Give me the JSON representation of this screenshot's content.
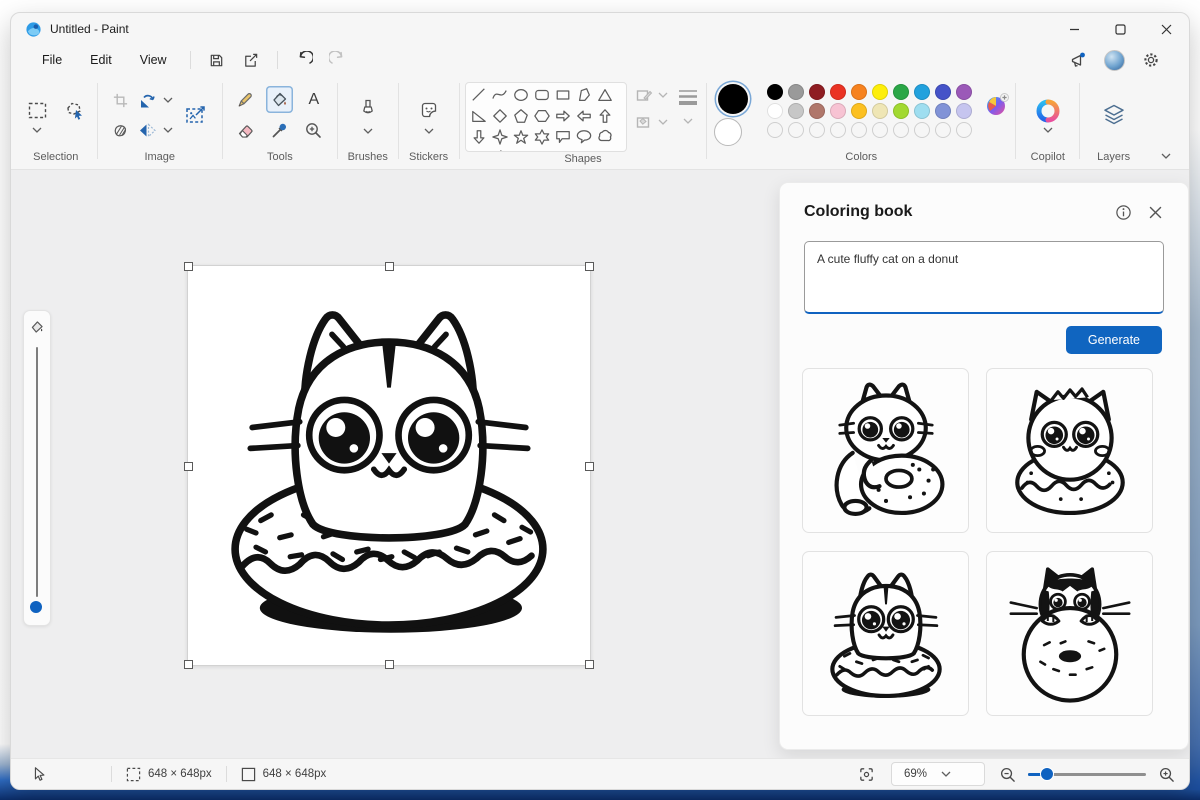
{
  "window": {
    "title": "Untitled - Paint"
  },
  "menubar": {
    "items": [
      "File",
      "Edit",
      "View"
    ]
  },
  "ribbon": {
    "groups": [
      {
        "label": "Selection"
      },
      {
        "label": "Image"
      },
      {
        "label": "Tools"
      },
      {
        "label": "Brushes"
      },
      {
        "label": "Stickers"
      },
      {
        "label": "Shapes"
      },
      {
        "label": "Colors"
      },
      {
        "label": "Copilot"
      },
      {
        "label": "Layers"
      }
    ],
    "selected_tool": "Fill"
  },
  "icons": {
    "text_tool": "A",
    "minimize": "minimize",
    "maximize": "maximize",
    "close": "close",
    "info": "info",
    "save": "floppy-disk",
    "share": "share-arrow",
    "undo": "undo-arrow",
    "redo": "redo-arrow",
    "feedback": "megaphone",
    "settings": "gear"
  },
  "colors": {
    "primary": "#000000",
    "secondary": "#ffffff",
    "row1": [
      "#000000",
      "#9a9a9a",
      "#8f1d22",
      "#ea3323",
      "#f6821f",
      "#fdee0a",
      "#2aa646",
      "#22a1dd",
      "#4553c8",
      "#9b59b8"
    ],
    "row2": [
      "#ffffff",
      "#c7c7c7",
      "#b0776b",
      "#f7c3d3",
      "#fcc021",
      "#efe6b5",
      "#a2d931",
      "#9fdef0",
      "#8193d7",
      "#c6c5ef"
    ],
    "empty_custom_slots": 10
  },
  "panel": {
    "title": "Coloring book",
    "prompt": "A cute fluffy cat on a donut",
    "generate_label": "Generate",
    "thumbnails": [
      {
        "alt": "Cat hugging a donut"
      },
      {
        "alt": "Fluffy cat head on a donut"
      },
      {
        "alt": "Cat sitting in a donut"
      },
      {
        "alt": "Black and white cat behind a donut"
      }
    ]
  },
  "canvas": {
    "content": "Line art of a cute cat sitting in a sprinkled donut"
  },
  "statusbar": {
    "selection_size": "648 × 648px",
    "image_size": "648 × 648px",
    "zoom_value": "69%"
  }
}
